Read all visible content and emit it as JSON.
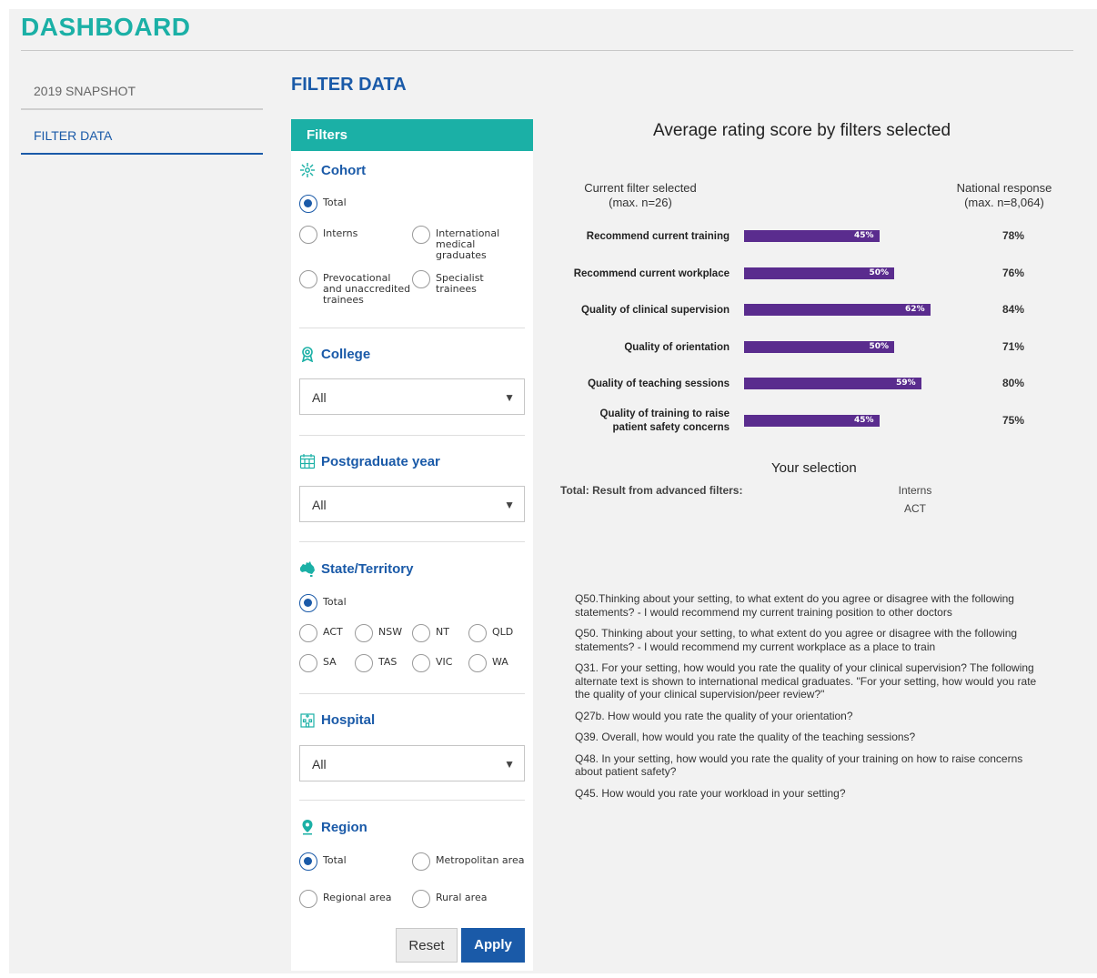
{
  "header": {
    "title": "DASHBOARD"
  },
  "nav": {
    "items": [
      {
        "label": "2019 SNAPSHOT"
      },
      {
        "label": "FILTER DATA"
      }
    ]
  },
  "page": {
    "section_title": "FILTER DATA"
  },
  "filters": {
    "title": "Filters",
    "cohort": {
      "title": "Cohort",
      "options": [
        {
          "label": "Total",
          "selected": true
        },
        {
          "label": "Interns",
          "selected": false
        },
        {
          "label": "International medical graduates",
          "selected": false
        },
        {
          "label": "Prevocational and unaccredited trainees",
          "selected": false
        },
        {
          "label": "Specialist trainees",
          "selected": false
        }
      ]
    },
    "college": {
      "title": "College",
      "value": "All"
    },
    "postgraduate_year": {
      "title": "Postgraduate year",
      "value": "All"
    },
    "state": {
      "title": "State/Territory",
      "options": [
        {
          "label": "Total",
          "selected": true
        },
        {
          "label": "ACT",
          "selected": false
        },
        {
          "label": "NSW",
          "selected": false
        },
        {
          "label": "NT",
          "selected": false
        },
        {
          "label": "QLD",
          "selected": false
        },
        {
          "label": "SA",
          "selected": false
        },
        {
          "label": "TAS",
          "selected": false
        },
        {
          "label": "VIC",
          "selected": false
        },
        {
          "label": "WA",
          "selected": false
        }
      ]
    },
    "hospital": {
      "title": "Hospital",
      "value": "All"
    },
    "region": {
      "title": "Region",
      "options": [
        {
          "label": "Total",
          "selected": true
        },
        {
          "label": "Metropolitan area",
          "selected": false
        },
        {
          "label": "Regional area",
          "selected": false
        },
        {
          "label": "Rural area",
          "selected": false
        }
      ]
    },
    "reset_label": "Reset",
    "apply_label": "Apply"
  },
  "chart_data": {
    "type": "bar",
    "title": "Average rating score by filters selected",
    "left_header": {
      "line1": "Current filter selected",
      "line2": "(max. n=26)"
    },
    "right_header": {
      "line1": "National response",
      "line2": "(max. n=8,064)"
    },
    "categories": [
      "Recommend current training",
      "Recommend current workplace",
      "Quality of clinical supervision",
      "Quality of orientation",
      "Quality of teaching sessions",
      "Quality of training to raise patient safety concerns"
    ],
    "series": [
      {
        "name": "Current filter selected",
        "values": [
          45,
          50,
          62,
          50,
          59,
          45
        ],
        "labels": [
          "45%",
          "50%",
          "62%",
          "50%",
          "59%",
          "45%"
        ]
      },
      {
        "name": "National response",
        "values": [
          78,
          76,
          84,
          71,
          80,
          75
        ],
        "labels": [
          "78%",
          "76%",
          "84%",
          "71%",
          "80%",
          "75%"
        ]
      }
    ],
    "bar_color": "#5a2c8e",
    "ylim": [
      0,
      100
    ]
  },
  "selection": {
    "title": "Your selection",
    "label": "Total: Result from advanced filters:",
    "values": [
      "Interns",
      "ACT"
    ]
  },
  "questions": [
    "Q50.Thinking about your setting, to what extent do you agree or disagree with the following statements? - I would recommend my current training position to other doctors",
    "Q50. Thinking about your setting, to what extent do you agree or disagree with the following statements? - I would recommend my current workplace as a place to train",
    "Q31. For your setting, how would you rate the quality of your clinical supervision? The following alternate text is shown to international medical graduates. \"For your setting, how would you rate the quality of your clinical supervision/peer review?\"",
    "Q27b. How would you rate the quality of your orientation?",
    "Q39. Overall, how would you rate the quality of the teaching sessions?",
    "Q48. In your setting, how would you rate the quality of your training on how to raise concerns about patient safety?",
    "Q45. How would you rate your workload in your setting?"
  ],
  "colors": {
    "teal": "#1bb0a6",
    "blue": "#1a5aa8",
    "purple": "#5a2c8e"
  }
}
